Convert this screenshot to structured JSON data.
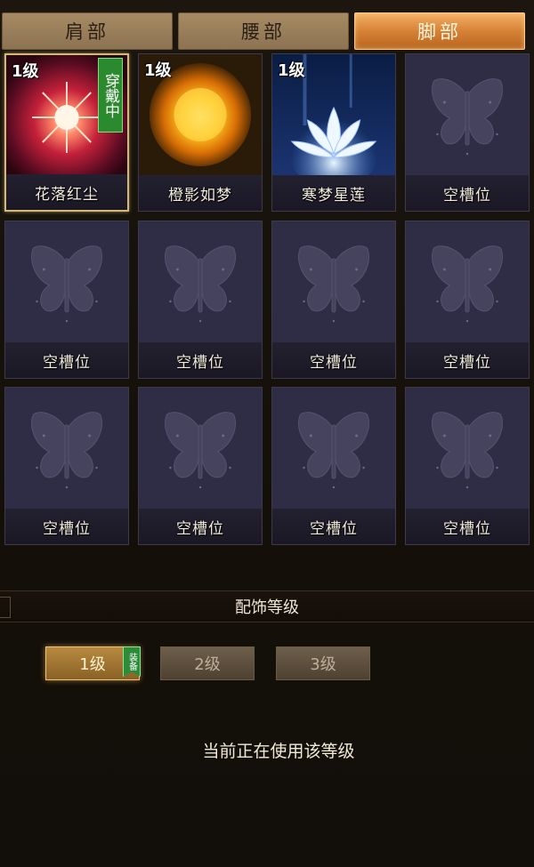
{
  "tabs": [
    {
      "label": "肩部",
      "active": false
    },
    {
      "label": "腰部",
      "active": false
    },
    {
      "label": "脚部",
      "active": true
    }
  ],
  "slots": [
    {
      "level": "1级",
      "name": "花落红尘",
      "art": "crimson-starburst-icon",
      "wearing": "穿戴中",
      "selected": true
    },
    {
      "level": "1级",
      "name": "橙影如梦",
      "art": "golden-sun-icon",
      "wearing": null,
      "selected": false
    },
    {
      "level": "1级",
      "name": "寒梦星莲",
      "art": "ice-lotus-icon",
      "wearing": null,
      "selected": false
    },
    {
      "level": null,
      "name": "空槽位",
      "art": "butterfly-placeholder-icon"
    },
    {
      "level": null,
      "name": "空槽位",
      "art": "butterfly-placeholder-icon"
    },
    {
      "level": null,
      "name": "空槽位",
      "art": "butterfly-placeholder-icon"
    },
    {
      "level": null,
      "name": "空槽位",
      "art": "butterfly-placeholder-icon"
    },
    {
      "level": null,
      "name": "空槽位",
      "art": "butterfly-placeholder-icon"
    },
    {
      "level": null,
      "name": "空槽位",
      "art": "butterfly-placeholder-icon"
    },
    {
      "level": null,
      "name": "空槽位",
      "art": "butterfly-placeholder-icon"
    },
    {
      "level": null,
      "name": "空槽位",
      "art": "butterfly-placeholder-icon"
    },
    {
      "level": null,
      "name": "空槽位",
      "art": "butterfly-placeholder-icon"
    }
  ],
  "level_section": {
    "title": "配饰等级",
    "levels": [
      "1级",
      "2级",
      "3级"
    ],
    "active_level": "1级",
    "equip_badge": "装备",
    "status": "当前正在使用该等级"
  },
  "colors": {
    "active_tab": "#d68236",
    "inactive_tab": "#a68a64",
    "wearing_badge": "#2c8a2e",
    "selected_border": "#d6b878",
    "slot_bg": "#2d2b44"
  }
}
